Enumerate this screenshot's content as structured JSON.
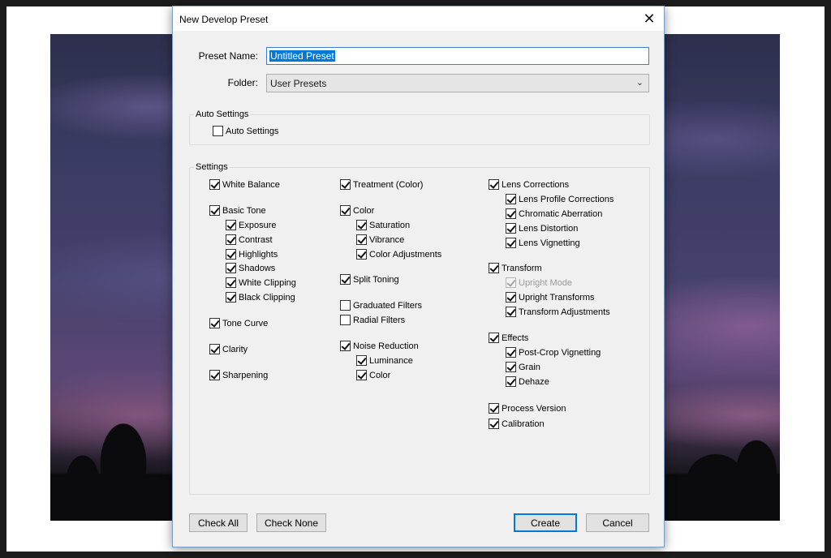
{
  "dialog": {
    "title": "New Develop Preset",
    "preset_name_label": "Preset Name:",
    "preset_name_value": "Untitled Preset",
    "folder_label": "Folder:",
    "folder_value": "User Presets"
  },
  "auto_settings": {
    "legend": "Auto Settings",
    "checkbox_label": "Auto Settings",
    "checked": false
  },
  "settings": {
    "legend": "Settings",
    "col1": [
      {
        "label": "White Balance",
        "checked": true
      },
      {
        "label": "Basic Tone",
        "checked": true
      },
      {
        "label": "Exposure",
        "checked": true
      },
      {
        "label": "Contrast",
        "checked": true
      },
      {
        "label": "Highlights",
        "checked": true
      },
      {
        "label": "Shadows",
        "checked": true
      },
      {
        "label": "White Clipping",
        "checked": true
      },
      {
        "label": "Black Clipping",
        "checked": true
      },
      {
        "label": "Tone Curve",
        "checked": true
      },
      {
        "label": "Clarity",
        "checked": true
      },
      {
        "label": "Sharpening",
        "checked": true
      }
    ],
    "col2": [
      {
        "label": "Treatment (Color)",
        "checked": true
      },
      {
        "label": "Color",
        "checked": true
      },
      {
        "label": "Saturation",
        "checked": true
      },
      {
        "label": "Vibrance",
        "checked": true
      },
      {
        "label": "Color Adjustments",
        "checked": true
      },
      {
        "label": "Split Toning",
        "checked": true
      },
      {
        "label": "Graduated Filters",
        "checked": false
      },
      {
        "label": "Radial Filters",
        "checked": false
      },
      {
        "label": "Noise Reduction",
        "checked": true
      },
      {
        "label": "Luminance",
        "checked": true
      },
      {
        "label": "Color",
        "checked": true
      }
    ],
    "col3": [
      {
        "label": "Lens Corrections",
        "checked": true
      },
      {
        "label": "Lens Profile Corrections",
        "checked": true
      },
      {
        "label": "Chromatic Aberration",
        "checked": true
      },
      {
        "label": "Lens Distortion",
        "checked": true
      },
      {
        "label": "Lens Vignetting",
        "checked": true
      },
      {
        "label": "Transform",
        "checked": true
      },
      {
        "label": "Upright Mode",
        "checked": true,
        "disabled": true
      },
      {
        "label": "Upright Transforms",
        "checked": true
      },
      {
        "label": "Transform Adjustments",
        "checked": true
      },
      {
        "label": "Effects",
        "checked": true
      },
      {
        "label": "Post-Crop Vignetting",
        "checked": true
      },
      {
        "label": "Grain",
        "checked": true
      },
      {
        "label": "Dehaze",
        "checked": true
      },
      {
        "label": "Process Version",
        "checked": true
      },
      {
        "label": "Calibration",
        "checked": true
      }
    ]
  },
  "buttons": {
    "check_all": "Check All",
    "check_none": "Check None",
    "create": "Create",
    "cancel": "Cancel"
  },
  "icons": {
    "close": "close-icon",
    "dropdown": "chevron-down-icon"
  }
}
